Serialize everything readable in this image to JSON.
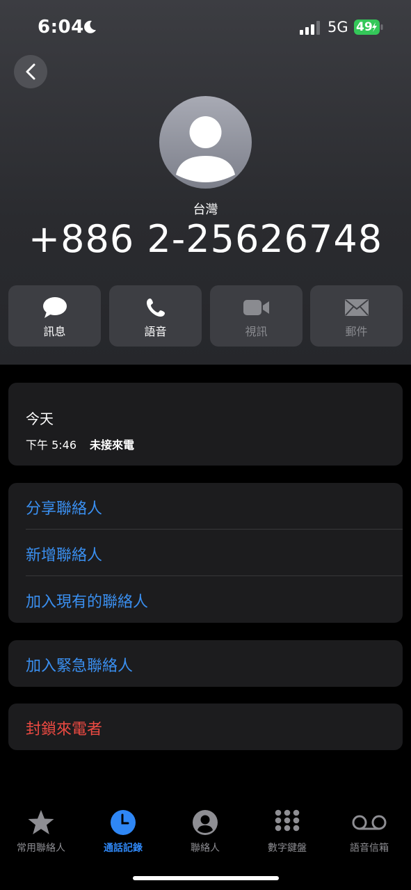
{
  "status": {
    "time": "6:04",
    "network": "5G",
    "battery": "49"
  },
  "contact": {
    "region": "台灣",
    "phone": "+886 2-25626748"
  },
  "actions": [
    {
      "label": "訊息",
      "icon": "message-icon",
      "enabled": true
    },
    {
      "label": "語音",
      "icon": "phone-icon",
      "enabled": true
    },
    {
      "label": "視訊",
      "icon": "video-icon",
      "enabled": false
    },
    {
      "label": "郵件",
      "icon": "mail-icon",
      "enabled": false
    }
  ],
  "call_log": {
    "day": "今天",
    "time": "下午 5:46",
    "status": "未接來電"
  },
  "contact_options": [
    "分享聯絡人",
    "新增聯絡人",
    "加入現有的聯絡人"
  ],
  "emergency": "加入緊急聯絡人",
  "block": "封鎖來電者",
  "tabs": [
    {
      "label": "常用聯絡人",
      "icon": "star-icon"
    },
    {
      "label": "通話記錄",
      "icon": "clock-icon",
      "active": true
    },
    {
      "label": "聯絡人",
      "icon": "person-circle-icon"
    },
    {
      "label": "數字鍵盤",
      "icon": "keypad-icon"
    },
    {
      "label": "語音信箱",
      "icon": "voicemail-icon"
    }
  ],
  "colors": {
    "accent": "#3a8ff0",
    "danger": "#eb4a42",
    "battery": "#34c759"
  }
}
